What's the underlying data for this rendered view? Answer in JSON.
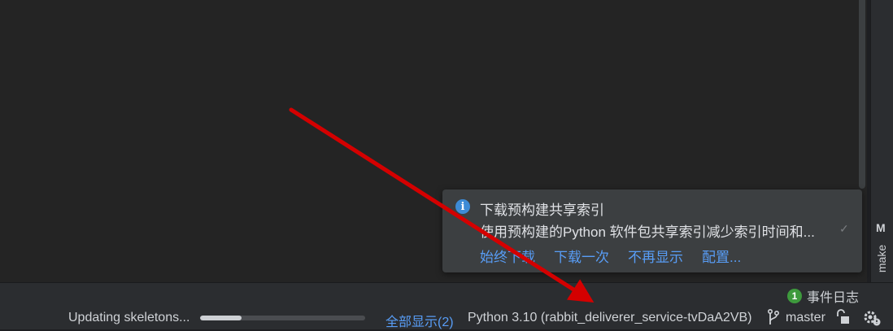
{
  "notification": {
    "title": "下载预构建共享索引",
    "body": "使用预构建的Python 软件包共享索引减少索引时间和...",
    "actions": [
      "始终下载",
      "下载一次",
      "不再显示",
      "配置..."
    ]
  },
  "side_tool": {
    "label": "make"
  },
  "status": {
    "event_log_count": "1",
    "event_log_label": "事件日志",
    "task_text": "Updating skeletons...",
    "progress": 0.25,
    "show_all": "全部显示(2)",
    "interpreter": "Python 3.10 (rabbit_deliverer_service-tvDaA2VB)",
    "branch": "master"
  },
  "colors": {
    "link": "#589df6",
    "annotation_arrow": "#d40000",
    "badge": "#3e9a3d"
  }
}
